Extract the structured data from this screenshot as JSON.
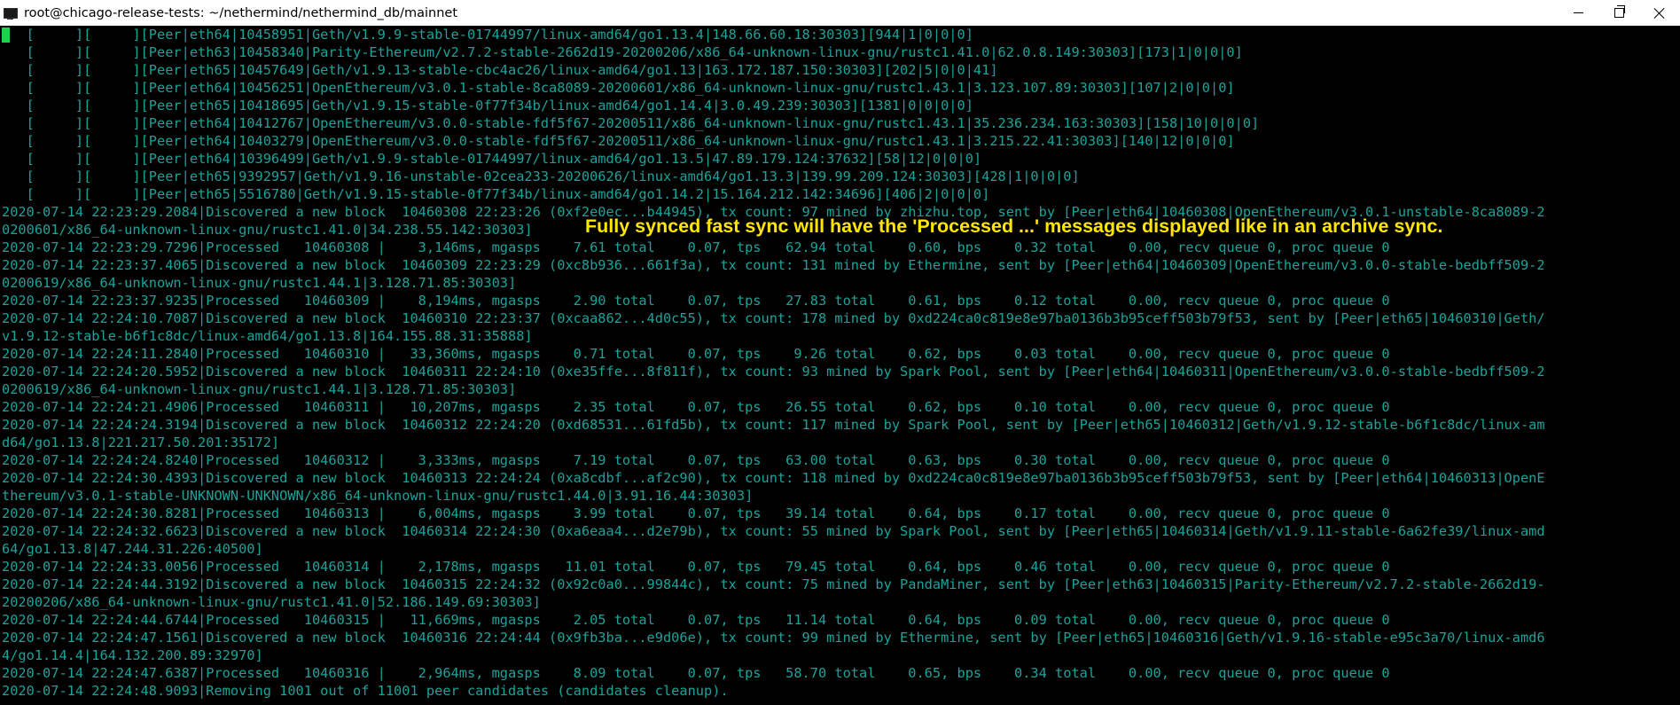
{
  "window": {
    "title": "root@chicago-release-tests: ~/nethermind/nethermind_db/mainnet"
  },
  "colors": {
    "terminal_text": "#1aa39a",
    "terminal_bg": "#000000",
    "annotation": "#ffe600",
    "cursor": "#21d14a"
  },
  "annotation": "Fully synced fast sync will have the 'Processed ...' messages displayed like in an archive sync.",
  "terminal": {
    "lines": [
      "   [     ][     ][Peer|eth64|10458951|Geth/v1.9.9-stable-01744997/linux-amd64/go1.13.4|148.66.60.18:30303][944|1|0|0|0]",
      "   [     ][     ][Peer|eth63|10458340|Parity-Ethereum/v2.7.2-stable-2662d19-20200206/x86_64-unknown-linux-gnu/rustc1.41.0|62.0.8.149:30303][173|1|0|0|0]",
      "   [     ][     ][Peer|eth65|10457649|Geth/v1.9.13-stable-cbc4ac26/linux-amd64/go1.13|163.172.187.150:30303][202|5|0|0|41]",
      "   [     ][     ][Peer|eth64|10456251|OpenEthereum/v3.0.1-stable-8ca8089-20200601/x86_64-unknown-linux-gnu/rustc1.43.1|3.123.107.89:30303][107|2|0|0|0]",
      "   [     ][     ][Peer|eth65|10418695|Geth/v1.9.15-stable-0f77f34b/linux-amd64/go1.14.4|3.0.49.239:30303][1381|0|0|0|0]",
      "   [     ][     ][Peer|eth64|10412767|OpenEthereum/v3.0.0-stable-fdf5f67-20200511/x86_64-unknown-linux-gnu/rustc1.43.1|35.236.234.163:30303][158|10|0|0|0]",
      "   [     ][     ][Peer|eth64|10403279|OpenEthereum/v3.0.0-stable-fdf5f67-20200511/x86_64-unknown-linux-gnu/rustc1.43.1|3.215.22.41:30303][140|12|0|0|0]",
      "   [     ][     ][Peer|eth64|10396499|Geth/v1.9.9-stable-01744997/linux-amd64/go1.13.5|47.89.179.124:37632][58|12|0|0|0]",
      "   [     ][     ][Peer|eth65|9392957|Geth/v1.9.16-unstable-02cea233-20200626/linux-amd64/go1.13.3|139.99.209.124:30303][428|1|0|0|0]",
      "   [     ][     ][Peer|eth65|5516780|Geth/v1.9.15-stable-0f77f34b/linux-amd64/go1.14.2|15.164.212.142:34696][406|2|0|0|0]",
      "2020-07-14 22:23:29.2084|Discovered a new block  10460308 22:23:26 (0xf2e0ec...b44945), tx count: 97 mined by zhizhu.top, sent by [Peer|eth64|10460308|OpenEthereum/v3.0.1-unstable-8ca8089-2",
      "0200601/x86_64-unknown-linux-gnu/rustc1.41.0|34.238.55.142:30303]",
      "2020-07-14 22:23:29.7296|Processed   10460308 |    3,146ms, mgasps    7.61 total    0.07, tps   62.94 total    0.60, bps    0.32 total    0.00, recv queue 0, proc queue 0",
      "2020-07-14 22:23:37.4065|Discovered a new block  10460309 22:23:29 (0xc8b936...661f3a), tx count: 131 mined by Ethermine, sent by [Peer|eth64|10460309|OpenEthereum/v3.0.0-stable-bedbff509-2",
      "0200619/x86_64-unknown-linux-gnu/rustc1.44.1|3.128.71.85:30303]",
      "2020-07-14 22:23:37.9235|Processed   10460309 |    8,194ms, mgasps    2.90 total    0.07, tps   27.83 total    0.61, bps    0.12 total    0.00, recv queue 0, proc queue 0",
      "2020-07-14 22:24:10.7087|Discovered a new block  10460310 22:23:37 (0xcaa862...4d0c55), tx count: 178 mined by 0xd224ca0c819e8e97ba0136b3b95ceff503b79f53, sent by [Peer|eth65|10460310|Geth/",
      "v1.9.12-stable-b6f1c8dc/linux-amd64/go1.13.8|164.155.88.31:35888]",
      "2020-07-14 22:24:11.2840|Processed   10460310 |   33,360ms, mgasps    0.71 total    0.07, tps    9.26 total    0.62, bps    0.03 total    0.00, recv queue 0, proc queue 0",
      "2020-07-14 22:24:20.5952|Discovered a new block  10460311 22:24:10 (0xe35ffe...8f811f), tx count: 93 mined by Spark Pool, sent by [Peer|eth64|10460311|OpenEthereum/v3.0.0-stable-bedbff509-2",
      "0200619/x86_64-unknown-linux-gnu/rustc1.44.1|3.128.71.85:30303]",
      "2020-07-14 22:24:21.4906|Processed   10460311 |   10,207ms, mgasps    2.35 total    0.07, tps   26.55 total    0.62, bps    0.10 total    0.00, recv queue 0, proc queue 0",
      "2020-07-14 22:24:24.3194|Discovered a new block  10460312 22:24:20 (0xd68531...61fd5b), tx count: 117 mined by Spark Pool, sent by [Peer|eth65|10460312|Geth/v1.9.12-stable-b6f1c8dc/linux-am",
      "d64/go1.13.8|221.217.50.201:35172]",
      "2020-07-14 22:24:24.8240|Processed   10460312 |    3,333ms, mgasps    7.19 total    0.07, tps   63.00 total    0.63, bps    0.30 total    0.00, recv queue 0, proc queue 0",
      "2020-07-14 22:24:30.4393|Discovered a new block  10460313 22:24:24 (0xa8cdbf...af2c90), tx count: 118 mined by 0xd224ca0c819e8e97ba0136b3b95ceff503b79f53, sent by [Peer|eth64|10460313|OpenE",
      "thereum/v3.0.1-stable-UNKNOWN-UNKNOWN/x86_64-unknown-linux-gnu/rustc1.44.0|3.91.16.44:30303]",
      "2020-07-14 22:24:30.8281|Processed   10460313 |    6,004ms, mgasps    3.99 total    0.07, tps   39.14 total    0.64, bps    0.17 total    0.00, recv queue 0, proc queue 0",
      "2020-07-14 22:24:32.6623|Discovered a new block  10460314 22:24:30 (0xa6eaa4...d2e79b), tx count: 55 mined by Spark Pool, sent by [Peer|eth65|10460314|Geth/v1.9.11-stable-6a62fe39/linux-amd",
      "64/go1.13.8|47.244.31.226:40500]",
      "2020-07-14 22:24:33.0056|Processed   10460314 |    2,178ms, mgasps   11.01 total    0.07, tps   79.45 total    0.64, bps    0.46 total    0.00, recv queue 0, proc queue 0",
      "2020-07-14 22:24:44.3192|Discovered a new block  10460315 22:24:32 (0x92c0a0...99844c), tx count: 75 mined by PandaMiner, sent by [Peer|eth63|10460315|Parity-Ethereum/v2.7.2-stable-2662d19-",
      "20200206/x86_64-unknown-linux-gnu/rustc1.41.0|52.186.149.69:30303]",
      "2020-07-14 22:24:44.6744|Processed   10460315 |   11,669ms, mgasps    2.05 total    0.07, tps   11.14 total    0.64, bps    0.09 total    0.00, recv queue 0, proc queue 0",
      "2020-07-14 22:24:47.1561|Discovered a new block  10460316 22:24:44 (0x9fb3ba...e9d06e), tx count: 99 mined by Ethermine, sent by [Peer|eth65|10460316|Geth/v1.9.16-stable-e95c3a70/linux-amd6",
      "4/go1.14.4|164.132.200.89:32970]",
      "2020-07-14 22:24:47.6387|Processed   10460316 |    2,964ms, mgasps    8.09 total    0.07, tps   58.70 total    0.65, bps    0.34 total    0.00, recv queue 0, proc queue 0",
      "2020-07-14 22:24:48.9093|Removing 1001 out of 11001 peer candidates (candidates cleanup)."
    ]
  }
}
